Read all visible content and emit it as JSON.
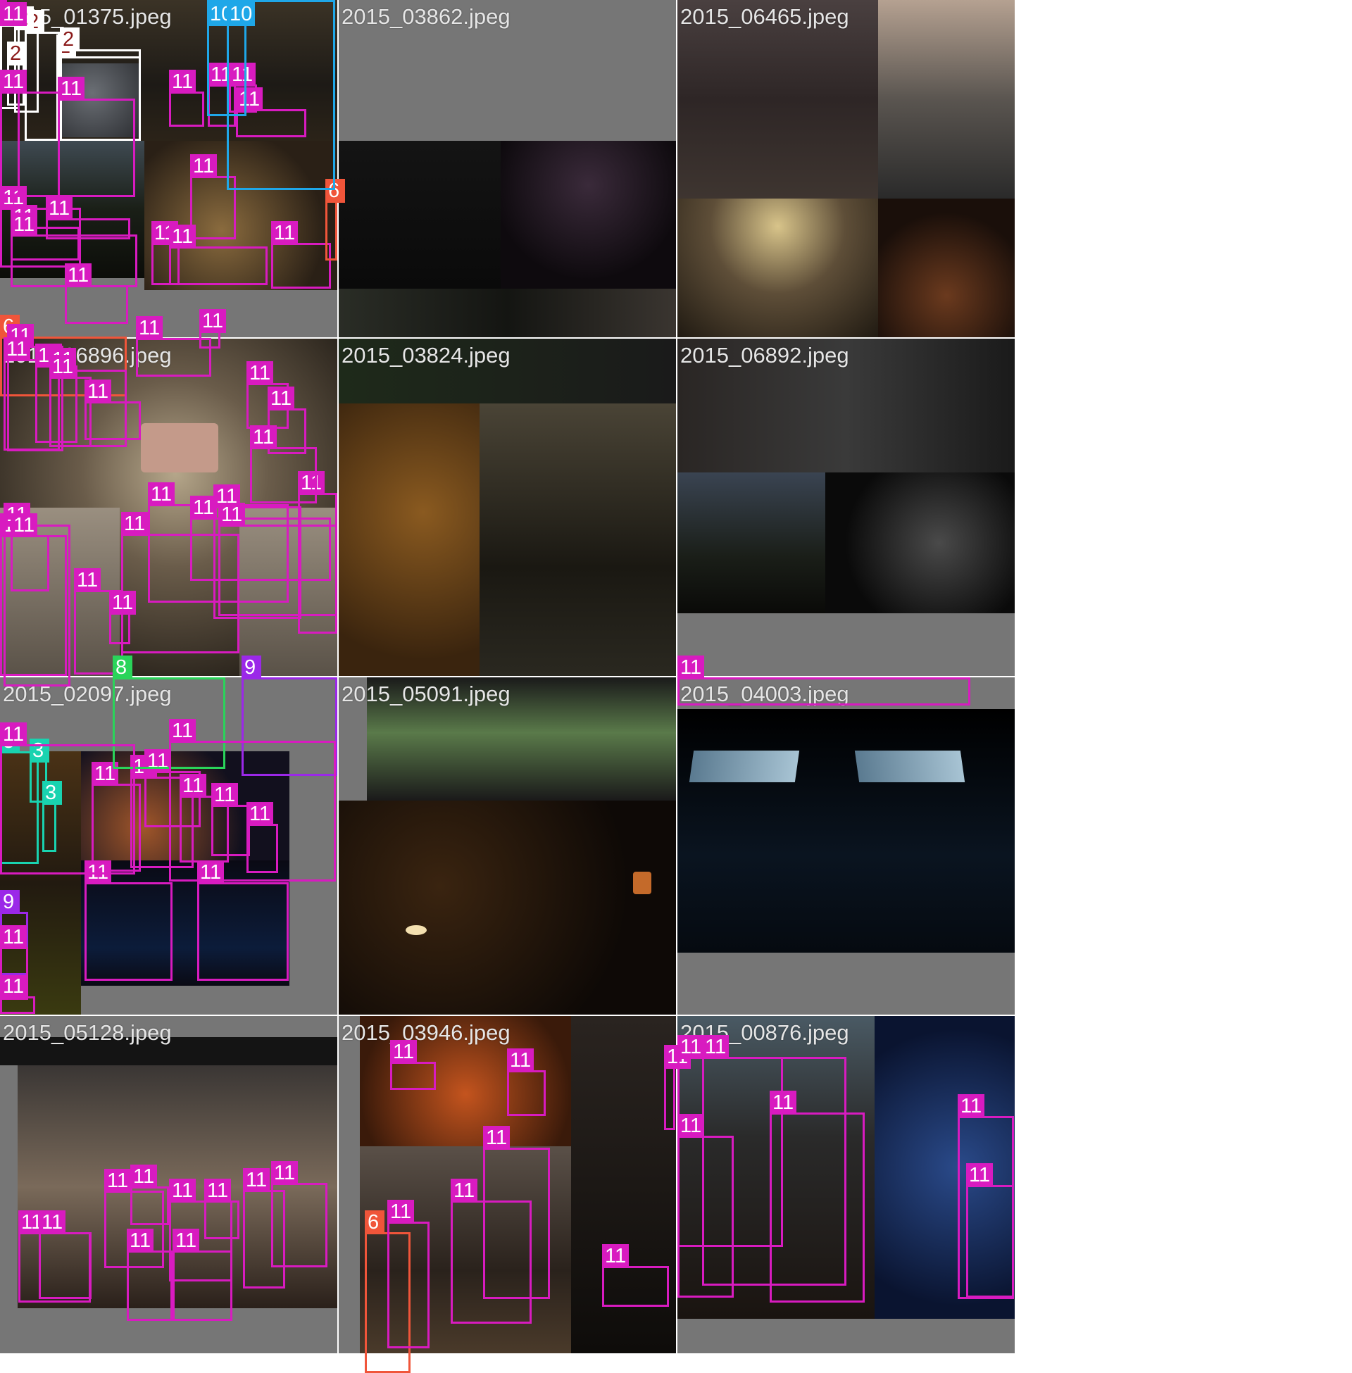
{
  "classes": {
    "2": {
      "color": "#ffffff",
      "text": "#8b1a1a"
    },
    "3": {
      "color": "#19d3b0",
      "text": "#ffffff"
    },
    "6": {
      "color": "#f0553a",
      "text": "#ffffff"
    },
    "8": {
      "color": "#2ad45a",
      "text": "#ffffff"
    },
    "9": {
      "color": "#9b28e8",
      "text": "#ffffff"
    },
    "10": {
      "color": "#1fa7e8",
      "text": "#ffffff"
    },
    "11": {
      "color": "#d81bc0",
      "text": "#ffffff"
    }
  },
  "tiles": [
    {
      "title": "2015_01375.jpeg"
    },
    {
      "title": "2015_03862.jpeg"
    },
    {
      "title": "2015_06465.jpeg"
    },
    {
      "title": "2015_06896.jpeg"
    },
    {
      "title": "2015_03824.jpeg"
    },
    {
      "title": "2015_06892.jpeg"
    },
    {
      "title": "2015_02097.jpeg"
    },
    {
      "title": "2015_05091.jpeg"
    },
    {
      "title": "2015_04003.jpeg"
    },
    {
      "title": "2015_05128.jpeg"
    },
    {
      "title": "2015_03946.jpeg"
    },
    {
      "title": "2015_00876.jpeg"
    }
  ],
  "detections": [
    {
      "tile": 0,
      "label": "2"
    },
    {
      "tile": 0,
      "label": "2"
    },
    {
      "tile": 0,
      "label": "2"
    },
    {
      "tile": 0,
      "label": "2"
    },
    {
      "tile": 0,
      "label": "2"
    },
    {
      "tile": 0,
      "label": "2"
    },
    {
      "tile": 0,
      "label": "11"
    },
    {
      "tile": 0,
      "label": "11"
    },
    {
      "tile": 0,
      "label": "11"
    },
    {
      "tile": 0,
      "label": "11"
    },
    {
      "tile": 0,
      "label": "11"
    },
    {
      "tile": 0,
      "label": "11"
    },
    {
      "tile": 0,
      "label": "11"
    },
    {
      "tile": 0,
      "label": "11"
    },
    {
      "tile": 0,
      "label": "11"
    },
    {
      "tile": 1,
      "label": "11"
    },
    {
      "tile": 1,
      "label": "11"
    },
    {
      "tile": 1,
      "label": "11"
    },
    {
      "tile": 1,
      "label": "6"
    },
    {
      "tile": 1,
      "label": "6"
    },
    {
      "tile": 1,
      "label": "11"
    },
    {
      "tile": 1,
      "label": "11"
    },
    {
      "tile": 2,
      "label": "11"
    },
    {
      "tile": 2,
      "label": "11"
    },
    {
      "tile": 2,
      "label": "10"
    },
    {
      "tile": 2,
      "label": "10"
    },
    {
      "tile": 2,
      "label": "11"
    },
    {
      "tile": 2,
      "label": "11"
    },
    {
      "tile": 3,
      "label": "11"
    },
    {
      "tile": 4,
      "label": "11"
    },
    {
      "tile": 4,
      "label": "11"
    },
    {
      "tile": 4,
      "label": "11"
    },
    {
      "tile": 4,
      "label": "11"
    },
    {
      "tile": 4,
      "label": "11"
    },
    {
      "tile": 4,
      "label": "11"
    },
    {
      "tile": 4,
      "label": "11"
    },
    {
      "tile": 4,
      "label": "9"
    },
    {
      "tile": 5,
      "label": "11"
    },
    {
      "tile": 5,
      "label": "11"
    },
    {
      "tile": 5,
      "label": "11"
    },
    {
      "tile": 5,
      "label": "11"
    },
    {
      "tile": 5,
      "label": "11"
    },
    {
      "tile": 5,
      "label": "11"
    },
    {
      "tile": 5,
      "label": "11"
    },
    {
      "tile": 5,
      "label": "11"
    },
    {
      "tile": 5,
      "label": "11"
    },
    {
      "tile": 5,
      "label": "11"
    },
    {
      "tile": 5,
      "label": "11"
    },
    {
      "tile": 5,
      "label": "11"
    },
    {
      "tile": 6,
      "label": "3"
    },
    {
      "tile": 6,
      "label": "3"
    },
    {
      "tile": 6,
      "label": "3"
    },
    {
      "tile": 6,
      "label": "11"
    },
    {
      "tile": 6,
      "label": "11"
    },
    {
      "tile": 6,
      "label": "11"
    },
    {
      "tile": 6,
      "label": "11"
    },
    {
      "tile": 6,
      "label": "11"
    },
    {
      "tile": 6,
      "label": "11"
    },
    {
      "tile": 6,
      "label": "11"
    },
    {
      "tile": 6,
      "label": "11"
    },
    {
      "tile": 6,
      "label": "11"
    },
    {
      "tile": 6,
      "label": "8"
    },
    {
      "tile": 7,
      "label": "9"
    },
    {
      "tile": 7,
      "label": "11"
    },
    {
      "tile": 7,
      "label": "11"
    },
    {
      "tile": 8,
      "label": "11"
    },
    {
      "tile": 8,
      "label": "11"
    },
    {
      "tile": 8,
      "label": "11"
    },
    {
      "tile": 9,
      "label": "11"
    },
    {
      "tile": 9,
      "label": "11"
    },
    {
      "tile": 9,
      "label": "11"
    },
    {
      "tile": 9,
      "label": "11"
    },
    {
      "tile": 9,
      "label": "11"
    },
    {
      "tile": 9,
      "label": "11"
    },
    {
      "tile": 9,
      "label": "11"
    },
    {
      "tile": 9,
      "label": "11"
    },
    {
      "tile": 9,
      "label": "11"
    },
    {
      "tile": 9,
      "label": "11"
    },
    {
      "tile": 10,
      "label": "11"
    },
    {
      "tile": 10,
      "label": "11"
    },
    {
      "tile": 10,
      "label": "6"
    },
    {
      "tile": 10,
      "label": "11"
    },
    {
      "tile": 10,
      "label": "11"
    },
    {
      "tile": 10,
      "label": "11"
    },
    {
      "tile": 10,
      "label": "11"
    },
    {
      "tile": 10,
      "label": "11"
    },
    {
      "tile": 11,
      "label": "11"
    },
    {
      "tile": 11,
      "label": "11"
    },
    {
      "tile": 11,
      "label": "11"
    },
    {
      "tile": 11,
      "label": "11"
    },
    {
      "tile": 11,
      "label": "11"
    },
    {
      "tile": 11,
      "label": "11"
    }
  ]
}
